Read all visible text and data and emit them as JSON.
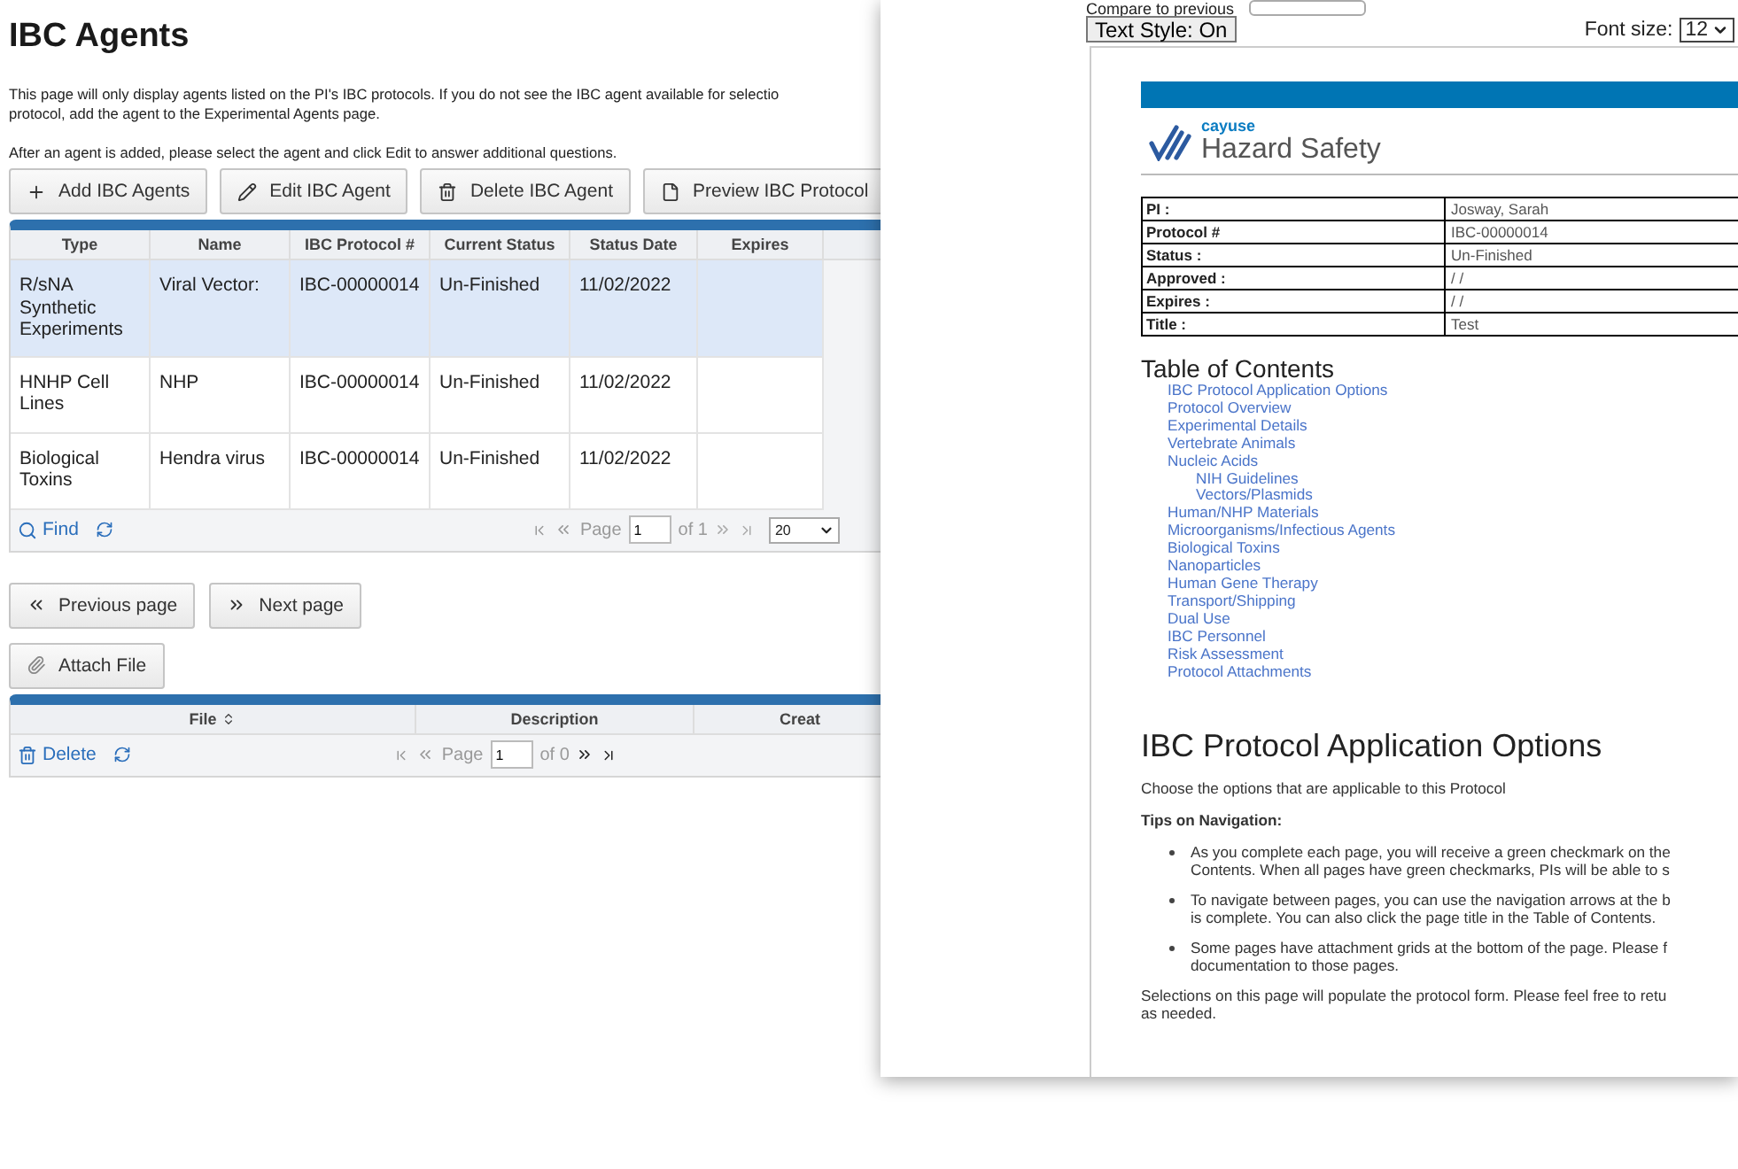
{
  "page": {
    "title": "IBC Agents",
    "intro_lines": [
      "This page will only display agents listed on the PI's IBC protocols. If you do not see the IBC agent available for selectio",
      "protocol, add the agent to the Experimental Agents page."
    ],
    "note": "After an agent is added, please select the agent and click Edit to answer additional questions."
  },
  "toolbar": [
    {
      "label": "Add IBC Agents",
      "kind": "add"
    },
    {
      "label": "Edit IBC Agent",
      "kind": "edit"
    },
    {
      "label": "Delete IBC Agent",
      "kind": "delete"
    },
    {
      "label": "Preview IBC Protocol",
      "kind": "preview"
    }
  ],
  "agents_grid": {
    "columns": [
      "Type",
      "Name",
      "IBC Protocol #",
      "Current Status",
      "Status Date",
      "Expires"
    ],
    "rows": [
      {
        "selected": true,
        "cells": [
          "R/sNA Synthetic Experiments",
          "Viral Vector:",
          "IBC-00000014",
          "Un-Finished",
          "11/02/2022"
        ]
      },
      {
        "selected": false,
        "cells": [
          "HNHP Cell Lines",
          "NHP",
          "IBC-00000014",
          "Un-Finished",
          "11/02/2022"
        ]
      },
      {
        "selected": false,
        "cells": [
          "Biological Toxins",
          "Hendra virus",
          "IBC-00000014",
          "Un-Finished",
          "11/02/2022"
        ]
      }
    ],
    "footer": {
      "action": "Find",
      "page_label": "Page",
      "page": "1",
      "of": "of 1",
      "next_enabled": false,
      "page_size": "20"
    }
  },
  "nav_buttons": [
    {
      "label": "Previous page",
      "kind": "prev"
    },
    {
      "label": "Next page",
      "kind": "next"
    }
  ],
  "attach_button": "Attach File",
  "files_grid": {
    "columns": [
      {
        "label": "File",
        "sortable": true
      },
      {
        "label": "Description",
        "sortable": false
      },
      {
        "label": "Creat",
        "sortable": false
      }
    ],
    "footer": {
      "action": "Delete",
      "page_label": "Page",
      "page": "1",
      "of": "of 0",
      "next_enabled": true
    }
  },
  "preview": {
    "compare_label": "Compare to previous",
    "text_style_button": "Text Style: On",
    "font_size_label": "Font size:",
    "font_size": "12",
    "logo": {
      "brand": "cayuse",
      "product": "Hazard Safety"
    },
    "info": [
      {
        "label": "PI :",
        "value": "Josway, Sarah"
      },
      {
        "label": "Protocol #",
        "value": "IBC-00000014"
      },
      {
        "label": "Status :",
        "value": "Un-Finished"
      },
      {
        "label": "Approved :",
        "value": "/ /"
      },
      {
        "label": "Expires :",
        "value": "/ /"
      },
      {
        "label": "Title :",
        "value": "Test"
      }
    ],
    "toc_title": "Table of Contents",
    "toc": [
      {
        "label": "IBC Protocol Application Options"
      },
      {
        "label": "Protocol Overview"
      },
      {
        "label": "Experimental Details"
      },
      {
        "label": "Vertebrate Animals"
      },
      {
        "label": "Nucleic Acids",
        "children": [
          {
            "label": "NIH Guidelines"
          },
          {
            "label": "Vectors/Plasmids"
          }
        ]
      },
      {
        "label": "Human/NHP Materials"
      },
      {
        "label": "Microorganisms/Infectious Agents"
      },
      {
        "label": "Biological Toxins"
      },
      {
        "label": "Nanoparticles"
      },
      {
        "label": "Human Gene Therapy"
      },
      {
        "label": "Transport/Shipping"
      },
      {
        "label": "Dual Use"
      },
      {
        "label": "IBC Personnel"
      },
      {
        "label": "Risk Assessment"
      },
      {
        "label": "Protocol Attachments"
      }
    ],
    "section_title": "IBC Protocol Application Options",
    "section_intro": "Choose the options that are applicable to this Protocol",
    "tips_title": "Tips on Navigation:",
    "tips": [
      [
        "As you complete each page, you will receive a green checkmark on the",
        "Contents. When all pages have green checkmarks, PIs will be able to s"
      ],
      [
        "To navigate between pages, you can use the navigation arrows at the b",
        "is complete. You can also click the page title in the Table of Contents."
      ],
      [
        "Some pages have attachment grids at the bottom of the page. Please f",
        "documentation to those pages."
      ]
    ],
    "closing": [
      "Selections on this page will populate the protocol form. Please feel free to retu",
      "as needed."
    ]
  }
}
